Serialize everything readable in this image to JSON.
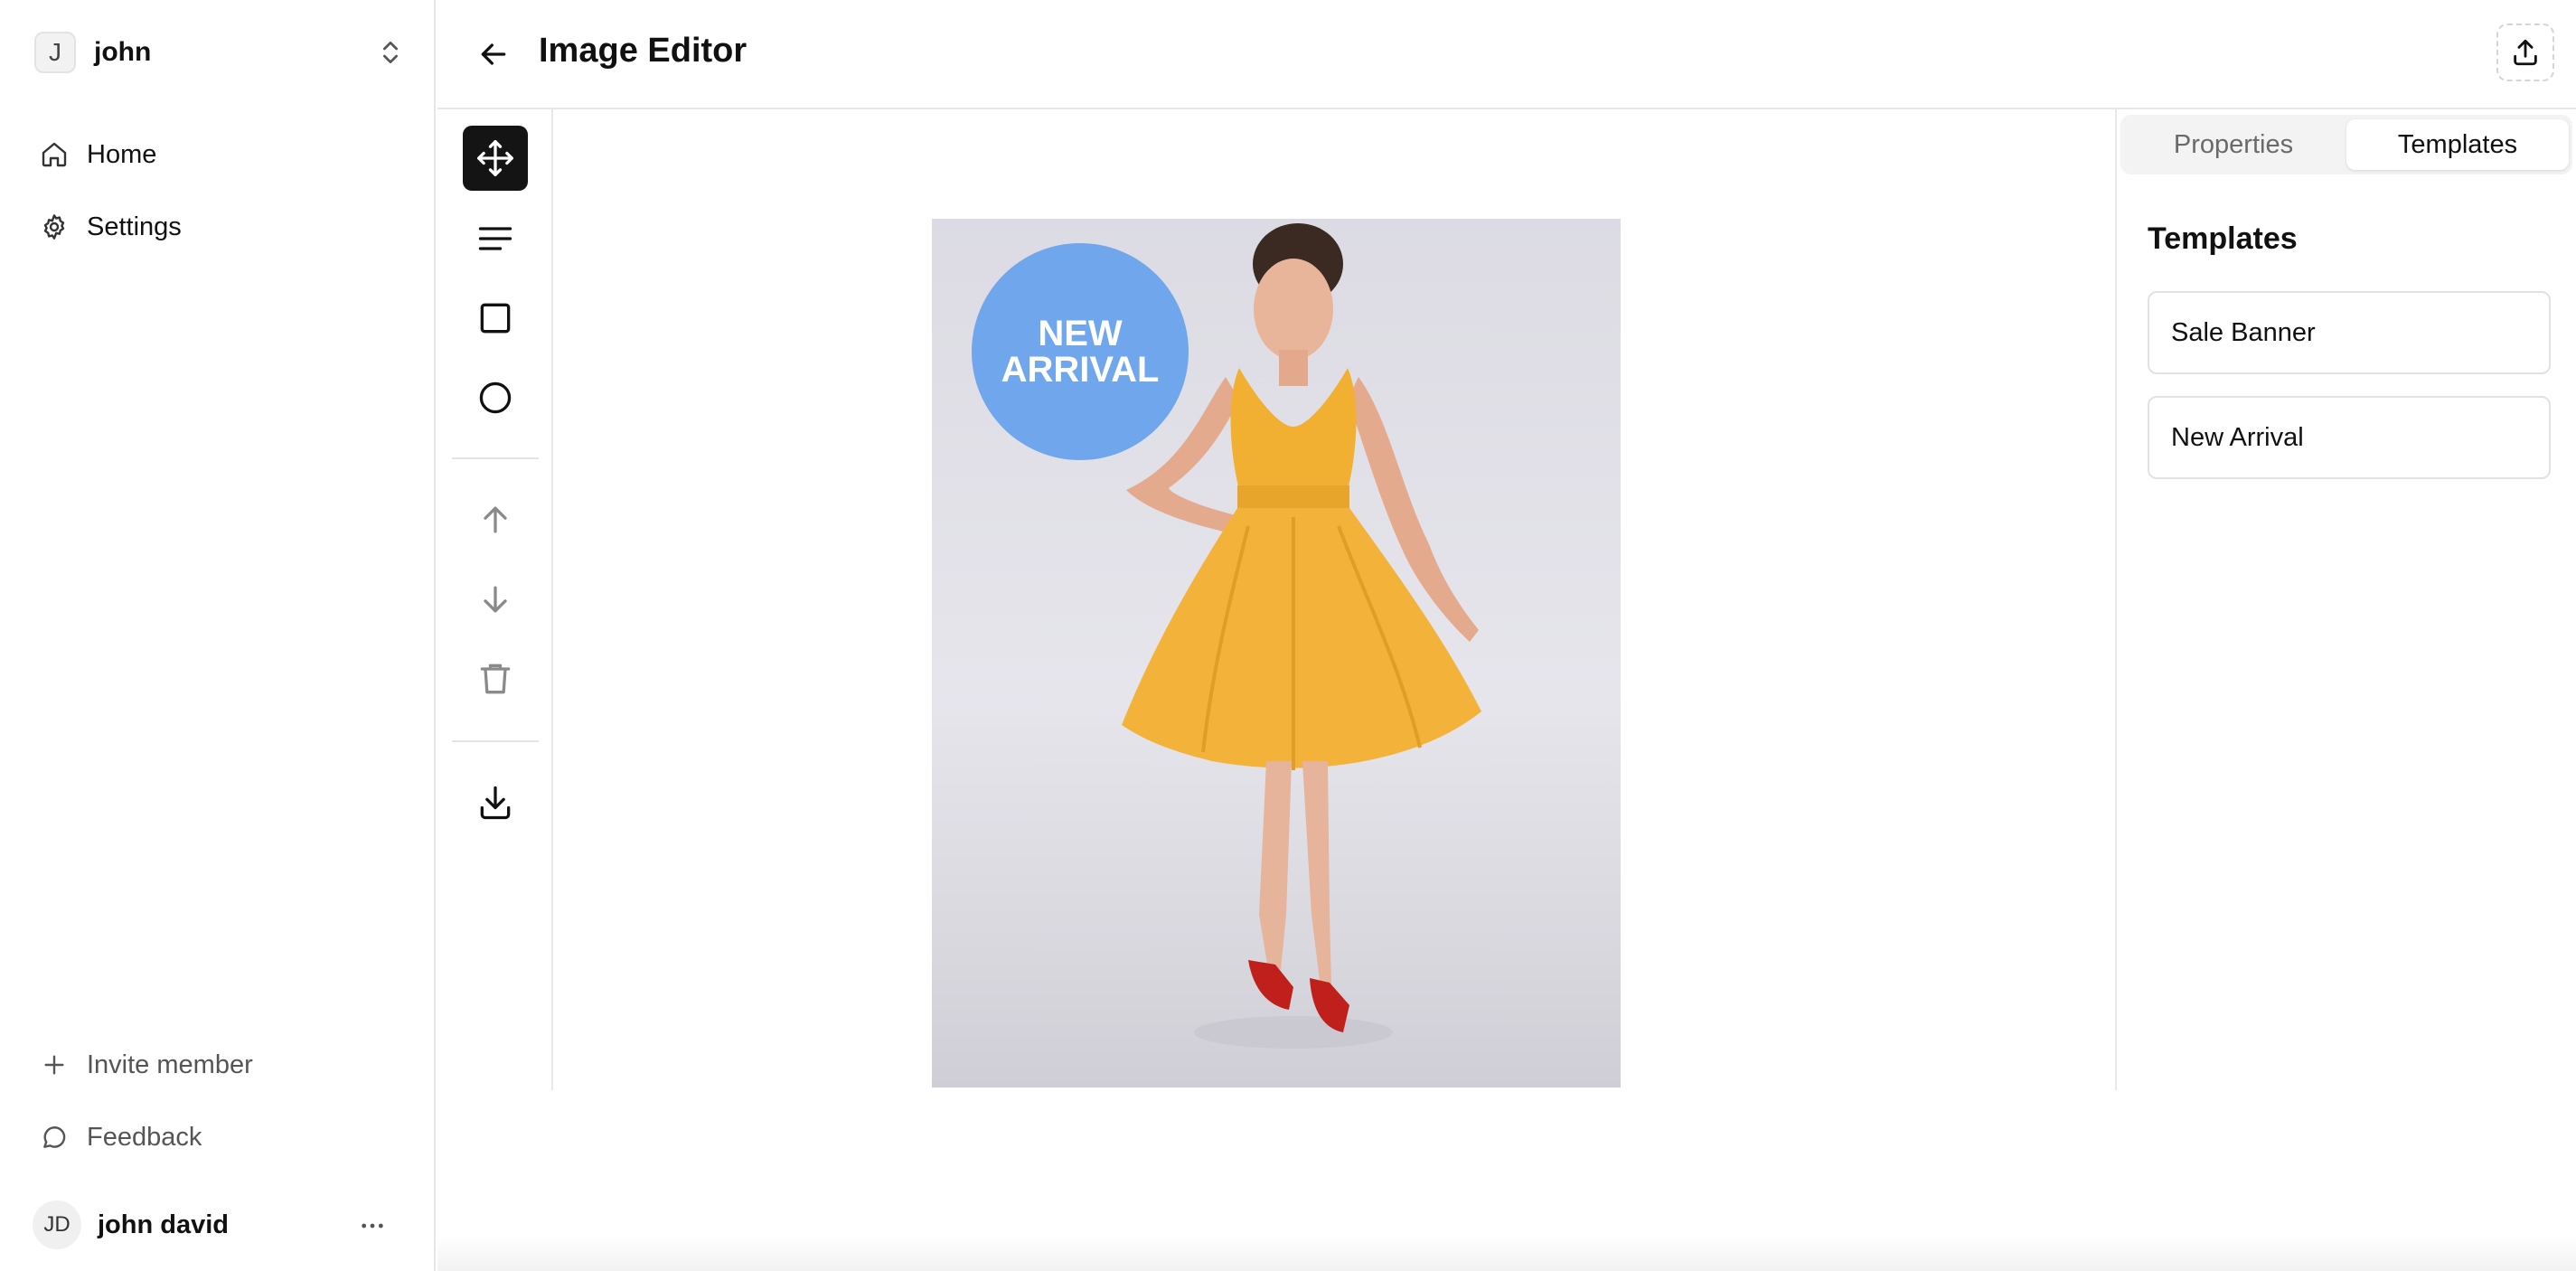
{
  "sidebar": {
    "workspace": {
      "initial": "J",
      "name": "john"
    },
    "nav": [
      {
        "label": "Home",
        "icon": "home-icon"
      },
      {
        "label": "Settings",
        "icon": "gear-icon"
      }
    ],
    "footer": [
      {
        "label": "Invite member",
        "icon": "plus-icon"
      },
      {
        "label": "Feedback",
        "icon": "chat-bubble-icon"
      }
    ],
    "user": {
      "initials": "JD",
      "name": "john david"
    }
  },
  "header": {
    "title": "Image Editor"
  },
  "toolbar": {
    "tools": [
      "move-icon",
      "text-icon",
      "rectangle-icon",
      "circle-icon",
      "arrow-up-icon",
      "arrow-down-icon",
      "trash-icon",
      "download-icon"
    ],
    "active": "move-icon"
  },
  "canvas": {
    "badge": {
      "line1": "NEW",
      "line2": "ARRIVAL",
      "color": "#6fa6ec"
    }
  },
  "panel": {
    "tabs": [
      {
        "label": "Properties",
        "active": false
      },
      {
        "label": "Templates",
        "active": true
      }
    ],
    "title": "Templates",
    "templates": [
      "Sale Banner",
      "New Arrival"
    ]
  }
}
